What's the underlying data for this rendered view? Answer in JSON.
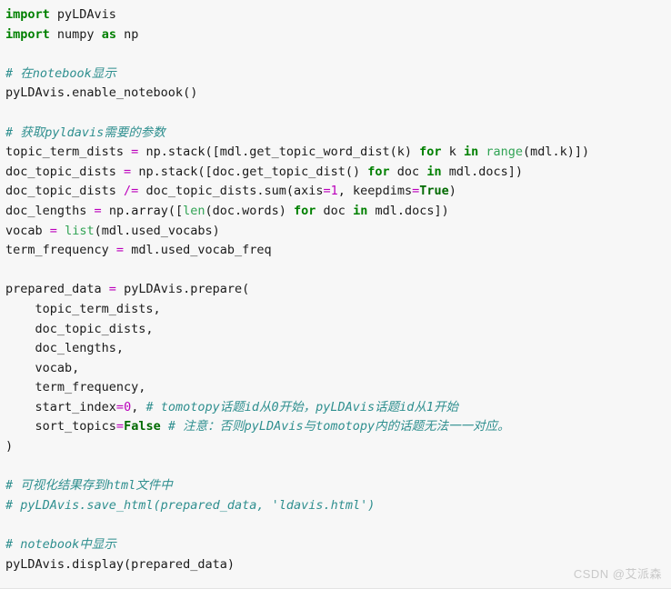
{
  "window": {
    "background_color": "#f7f7f7",
    "language": "python"
  },
  "theme": {
    "keyword_color": "#008000",
    "constant_color": "#006a00",
    "builtin_color": "#31a354",
    "operator_color": "#bb00bb",
    "number_color": "#bb00bb",
    "comment_color": "#2f8f8f",
    "plain_color": "#1a1a1a",
    "background_color": "#f7f7f7"
  },
  "code": {
    "lines": [
      [
        {
          "t": "import",
          "c": "kw"
        },
        {
          "t": " pyLDAvis",
          "c": "pln"
        }
      ],
      [
        {
          "t": "import",
          "c": "kw"
        },
        {
          "t": " numpy ",
          "c": "pln"
        },
        {
          "t": "as",
          "c": "kw"
        },
        {
          "t": " np",
          "c": "pln"
        }
      ],
      [],
      [
        {
          "t": "# 在notebook显示",
          "c": "cmt"
        }
      ],
      [
        {
          "t": "pyLDAvis.enable_notebook()",
          "c": "pln"
        }
      ],
      [],
      [
        {
          "t": "# 获取pyldavis需要的参数",
          "c": "cmt"
        }
      ],
      [
        {
          "t": "topic_term_dists ",
          "c": "pln"
        },
        {
          "t": "=",
          "c": "op"
        },
        {
          "t": " np.stack([mdl.get_topic_word_dist(k) ",
          "c": "pln"
        },
        {
          "t": "for",
          "c": "kw"
        },
        {
          "t": " k ",
          "c": "pln"
        },
        {
          "t": "in",
          "c": "kw"
        },
        {
          "t": " ",
          "c": "pln"
        },
        {
          "t": "range",
          "c": "builtin"
        },
        {
          "t": "(mdl.k)])",
          "c": "pln"
        }
      ],
      [
        {
          "t": "doc_topic_dists ",
          "c": "pln"
        },
        {
          "t": "=",
          "c": "op"
        },
        {
          "t": " np.stack([doc.get_topic_dist() ",
          "c": "pln"
        },
        {
          "t": "for",
          "c": "kw"
        },
        {
          "t": " doc ",
          "c": "pln"
        },
        {
          "t": "in",
          "c": "kw"
        },
        {
          "t": " mdl.docs])",
          "c": "pln"
        }
      ],
      [
        {
          "t": "doc_topic_dists ",
          "c": "pln"
        },
        {
          "t": "/=",
          "c": "op"
        },
        {
          "t": " doc_topic_dists.sum(axis",
          "c": "pln"
        },
        {
          "t": "=",
          "c": "op"
        },
        {
          "t": "1",
          "c": "num"
        },
        {
          "t": ", keepdims",
          "c": "pln"
        },
        {
          "t": "=",
          "c": "op"
        },
        {
          "t": "True",
          "c": "kwc"
        },
        {
          "t": ")",
          "c": "pln"
        }
      ],
      [
        {
          "t": "doc_lengths ",
          "c": "pln"
        },
        {
          "t": "=",
          "c": "op"
        },
        {
          "t": " np.array([",
          "c": "pln"
        },
        {
          "t": "len",
          "c": "builtin"
        },
        {
          "t": "(doc.words) ",
          "c": "pln"
        },
        {
          "t": "for",
          "c": "kw"
        },
        {
          "t": " doc ",
          "c": "pln"
        },
        {
          "t": "in",
          "c": "kw"
        },
        {
          "t": " mdl.docs])",
          "c": "pln"
        }
      ],
      [
        {
          "t": "vocab ",
          "c": "pln"
        },
        {
          "t": "=",
          "c": "op"
        },
        {
          "t": " ",
          "c": "pln"
        },
        {
          "t": "list",
          "c": "builtin"
        },
        {
          "t": "(mdl.used_vocabs)",
          "c": "pln"
        }
      ],
      [
        {
          "t": "term_frequency ",
          "c": "pln"
        },
        {
          "t": "=",
          "c": "op"
        },
        {
          "t": " mdl.used_vocab_freq",
          "c": "pln"
        }
      ],
      [],
      [
        {
          "t": "prepared_data ",
          "c": "pln"
        },
        {
          "t": "=",
          "c": "op"
        },
        {
          "t": " pyLDAvis.prepare(",
          "c": "pln"
        }
      ],
      [
        {
          "t": "    topic_term_dists,",
          "c": "pln"
        }
      ],
      [
        {
          "t": "    doc_topic_dists,",
          "c": "pln"
        }
      ],
      [
        {
          "t": "    doc_lengths,",
          "c": "pln"
        }
      ],
      [
        {
          "t": "    vocab,",
          "c": "pln"
        }
      ],
      [
        {
          "t": "    term_frequency,",
          "c": "pln"
        }
      ],
      [
        {
          "t": "    start_index",
          "c": "pln"
        },
        {
          "t": "=",
          "c": "op"
        },
        {
          "t": "0",
          "c": "num"
        },
        {
          "t": ", ",
          "c": "pln"
        },
        {
          "t": "# tomotopy话题id从0开始，pyLDAvis话题id从1开始",
          "c": "cmt"
        }
      ],
      [
        {
          "t": "    sort_topics",
          "c": "pln"
        },
        {
          "t": "=",
          "c": "op"
        },
        {
          "t": "False",
          "c": "kwc"
        },
        {
          "t": " ",
          "c": "pln"
        },
        {
          "t": "# 注意：否则pyLDAvis与tomotopy内的话题无法一一对应。",
          "c": "cmt"
        }
      ],
      [
        {
          "t": ")",
          "c": "pln"
        }
      ],
      [],
      [
        {
          "t": "# 可视化结果存到html文件中",
          "c": "cmt"
        }
      ],
      [
        {
          "t": "# pyLDAvis.save_html(prepared_data, 'ldavis.html')",
          "c": "cmt"
        }
      ],
      [],
      [
        {
          "t": "# notebook中显示",
          "c": "cmt"
        }
      ],
      [
        {
          "t": "pyLDAvis.display(prepared_data)",
          "c": "pln"
        }
      ]
    ]
  },
  "watermark": {
    "text": "CSDN @艾派森",
    "color": "#c9c9c9"
  }
}
